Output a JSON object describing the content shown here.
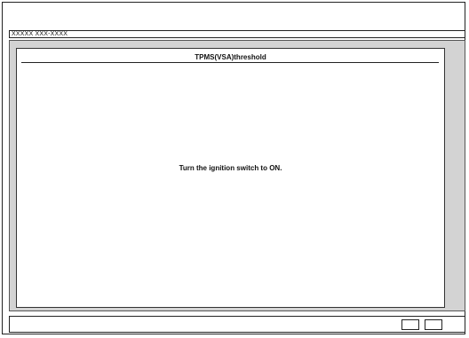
{
  "header": {
    "id_label": "XXXXX XXX-XXXX"
  },
  "dialog": {
    "title": "TPMS(VSA)threshold",
    "message": "Turn the ignition switch to ON."
  },
  "status_bar": {
    "buttons": [
      "",
      ""
    ]
  }
}
